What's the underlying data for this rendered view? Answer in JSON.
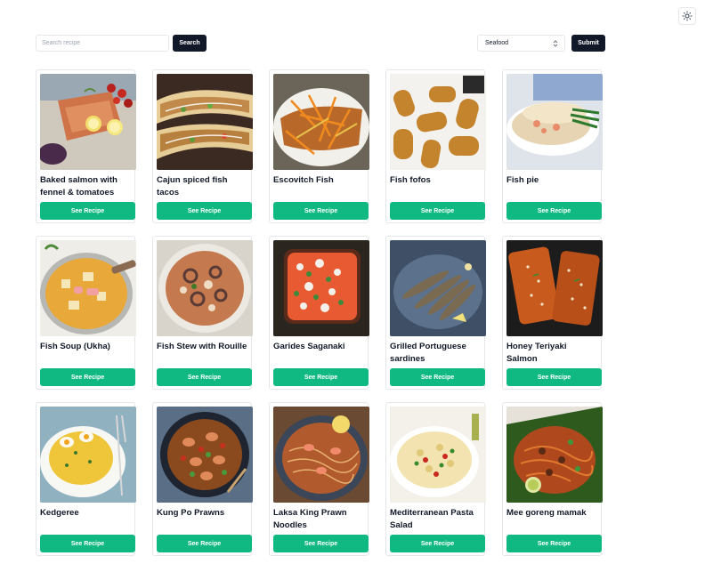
{
  "header": {
    "search_placeholder": "Search recipe",
    "search_value": "",
    "search_label": "Search",
    "category_selected": "Seafood",
    "submit_label": "Submit",
    "theme_icon": "sun-icon"
  },
  "colors": {
    "primary_dark": "#111827",
    "accent_green": "#10b981",
    "border": "#e5e7eb"
  },
  "recipes": [
    {
      "title": "Baked salmon with fennel & tomatoes",
      "button": "See Recipe"
    },
    {
      "title": "Cajun spiced fish tacos",
      "button": "See Recipe"
    },
    {
      "title": "Escovitch Fish",
      "button": "See Recipe"
    },
    {
      "title": "Fish fofos",
      "button": "See Recipe"
    },
    {
      "title": "Fish pie",
      "button": "See Recipe"
    },
    {
      "title": "Fish Soup (Ukha)",
      "button": "See Recipe"
    },
    {
      "title": "Fish Stew with Rouille",
      "button": "See Recipe"
    },
    {
      "title": "Garides Saganaki",
      "button": "See Recipe"
    },
    {
      "title": "Grilled Portuguese sardines",
      "button": "See Recipe"
    },
    {
      "title": "Honey Teriyaki Salmon",
      "button": "See Recipe"
    },
    {
      "title": "Kedgeree",
      "button": "See Recipe"
    },
    {
      "title": "Kung Po Prawns",
      "button": "See Recipe"
    },
    {
      "title": "Laksa King Prawn Noodles",
      "button": "See Recipe"
    },
    {
      "title": "Mediterranean Pasta Salad",
      "button": "See Recipe"
    },
    {
      "title": "Mee goreng mamak",
      "button": "See Recipe"
    }
  ]
}
